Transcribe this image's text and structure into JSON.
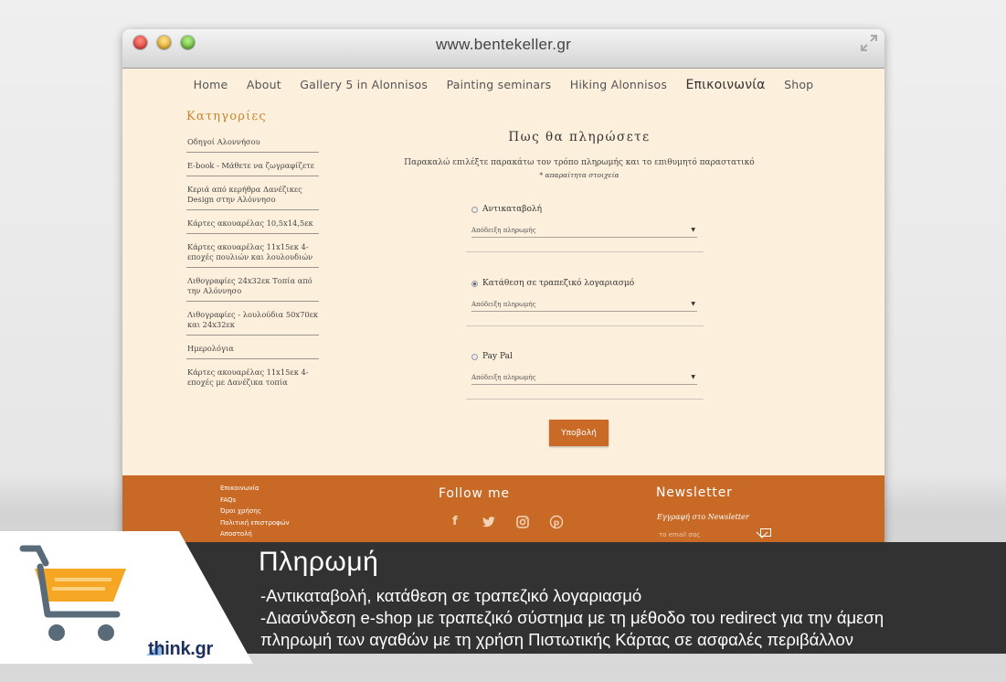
{
  "browser": {
    "url": "www.bentekeller.gr"
  },
  "nav": {
    "items": [
      "Home",
      "About",
      "Gallery 5 in Alonnisos",
      "Painting seminars",
      "Hiking Alonnisos",
      "Επικοινωνία",
      "Shop"
    ],
    "active": "Επικοινωνία"
  },
  "sidebar": {
    "title": "Κατηγορίες",
    "items": [
      "Οδηγοί Αλοννήσου",
      "E-book - Μάθετε να ζωγραφίζετε",
      "Κεριά από κερήθρα Δανέζικες Design στην Αλόννησο",
      "Κάρτες ακουαρέλας 10,5x14,5εκ",
      "Κάρτες ακουαρέλας 11x15εκ 4-εποχές πουλιών και λουλουδιών",
      "Λιθογραφίες 24x32εκ Τοπία από την Αλόννησο",
      "Λιθογραφίες - λουλούδια 50x70εκ και 24x32εκ",
      "Ημερολόγια",
      "Κάρτες ακουαρέλας 11x15εκ 4-εποχές με Δανέζικα τοπία"
    ]
  },
  "main": {
    "title": "Πως θα πληρώσετε",
    "intro": "Παρακαλώ επιλέξτε παρακάτω τον τρόπο πληρωμής και το επιθυμητό παραστατικό",
    "required_note": "* απαραίτητα στοιχεία",
    "options": [
      {
        "label": "Αντικαταβολή",
        "selected": false,
        "select_value": "Απόδειξη πληρωμής"
      },
      {
        "label": "Κατάθεση σε τραπεζικό λογαριασμό",
        "selected": true,
        "select_value": "Απόδειξη πληρωμής"
      },
      {
        "label": "Pay Pal",
        "selected": false,
        "select_value": "Απόδειξη πληρωμής"
      }
    ],
    "submit_label": "Υποβολή"
  },
  "footer": {
    "links": [
      "Επικοινωνία",
      "FAQs",
      "Όροι χρήσης",
      "Πολιτική επιστροφών",
      "Αποστολή"
    ],
    "follow_title": "Follow me",
    "social_icons": [
      "facebook-icon",
      "twitter-icon",
      "instagram-icon",
      "pinterest-icon"
    ],
    "newsletter_title": "Newsletter",
    "newsletter_subtitle": "Εγγραφή στο Newsletter",
    "newsletter_placeholder": "το email σας"
  },
  "banner": {
    "title": "Πληρωμή",
    "lines": [
      "-Αντικαταβολή, κατάθεση σε τραπεζικό λογαριασμό",
      "-Διασύνδεση e-shop με τραπεζικό σύστημα με τη μέθοδο του redirect για την άμεση",
      "πληρωμή των αγαθών με τη χρήση Πιστωτικής Κάρτας σε ασφαλές περιβάλλον"
    ],
    "brand": "think.gr"
  },
  "colors": {
    "accent": "#c96a27",
    "page_bg": "#fcefdc",
    "banner_bg": "#323232",
    "cart_orange": "#f5a623"
  }
}
